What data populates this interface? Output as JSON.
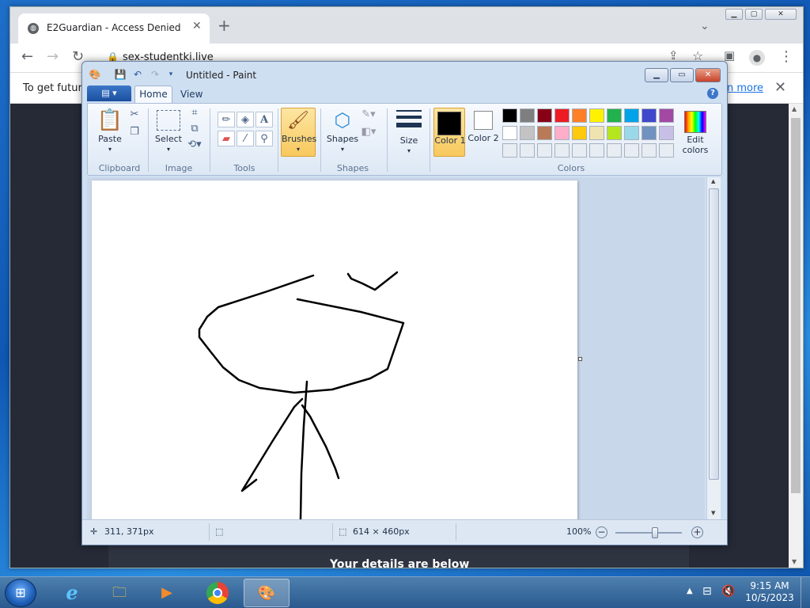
{
  "chrome": {
    "tab_title": "E2Guardian - Access Denied",
    "url": "sex-studentki.live",
    "infobar_text": "To get future",
    "infobar_link": "n more",
    "page_partial_text": "Your details are below"
  },
  "paint": {
    "title": "Untitled - Paint",
    "tabs": {
      "home": "Home",
      "view": "View"
    },
    "groups": {
      "clipboard": "Clipboard",
      "image": "Image",
      "tools": "Tools",
      "shapes": "Shapes",
      "colors": "Colors"
    },
    "buttons": {
      "paste": "Paste",
      "select": "Select",
      "brushes": "Brushes",
      "shapes": "Shapes",
      "size": "Size",
      "color1": "Color 1",
      "color2": "Color 2",
      "edit_colors": "Edit colors"
    },
    "palette_row1": [
      "#000000",
      "#7f7f7f",
      "#880015",
      "#ed1c24",
      "#ff7f27",
      "#fff200",
      "#22b14c",
      "#00a2e8",
      "#3f48cc",
      "#a349a4"
    ],
    "palette_row2": [
      "#ffffff",
      "#c3c3c3",
      "#b97a57",
      "#ffaec9",
      "#ffc90e",
      "#efe4b0",
      "#b5e61d",
      "#99d9ea",
      "#7092be",
      "#c8bfe7"
    ],
    "color1": "#000000",
    "color2": "#ffffff",
    "status": {
      "cursor_pos": "311, 371px",
      "canvas_size": "614 × 460px",
      "zoom": "100%"
    },
    "zoom_fraction": 0.6
  },
  "taskbar": {
    "time": "9:15 AM",
    "date": "10/5/2023"
  }
}
